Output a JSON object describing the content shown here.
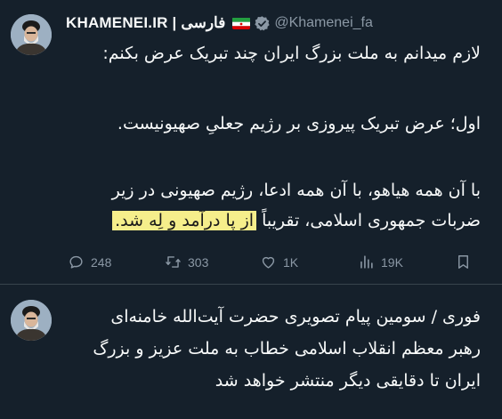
{
  "tweet1": {
    "name": "KHAMENEI.IR | فارسی",
    "handle": "@Khamenei_fa",
    "lines": [
      "لازم میدانم به ملت بزرگ ایران چند تبریک عرض بکنم:",
      "اول؛ عرض تبریک پیروزی بر رژیم جعلیِ صهیونیست.",
      "با آن همه هیاهو، با آن همه ادعا، رژیم صهیونی در زیر",
      "ضربات جمهوری اسلامی، تقریباً "
    ],
    "highlight": "از پا درآمد و لِه شد.",
    "stats": {
      "replies": "248",
      "retweets": "303",
      "likes": "1K",
      "views": "19K"
    }
  },
  "tweet2": {
    "lines": [
      "فوری / سومین پیام تصویری حضرت آیت‌الله خامنه‌ای",
      "رهبر معظم انقلاب اسلامی خطاب به ملت عزیز و بزرگ",
      "ایران تا دقایقی دیگر منتشر خواهد شد"
    ]
  },
  "icons": {
    "verified": "verified-badge-icon",
    "flag": "iran-flag-icon",
    "reply": "reply-icon",
    "retweet": "retweet-icon",
    "like": "heart-icon",
    "views": "views-icon",
    "share": "share-icon"
  },
  "colors": {
    "background": "#15202b",
    "text": "#f7f9f9",
    "muted": "#8b98a5",
    "highlight": "#f5ee8b",
    "verified": "#8b98a5"
  }
}
